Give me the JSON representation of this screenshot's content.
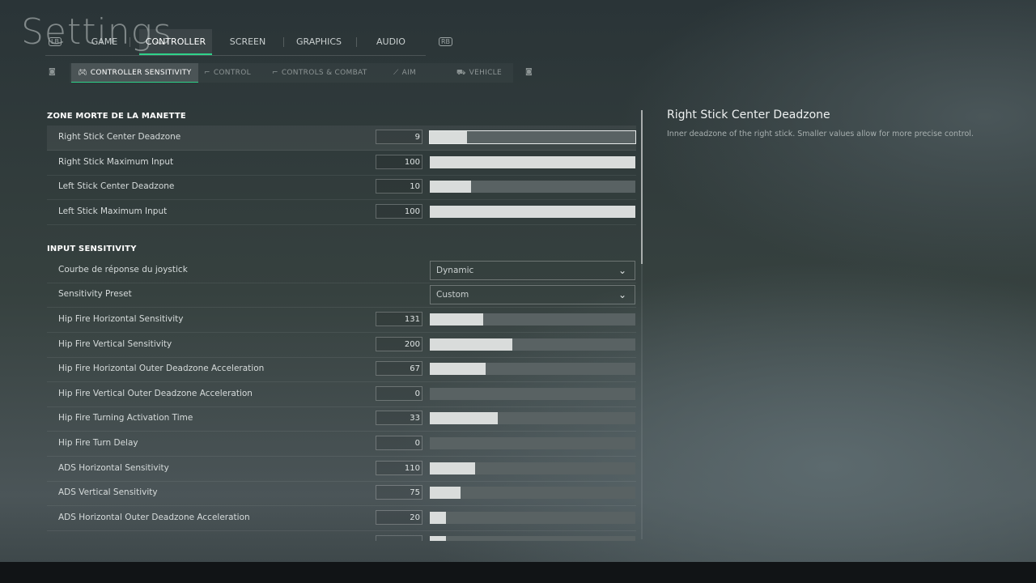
{
  "page": {
    "title": "Settings"
  },
  "tabs": [
    {
      "label": "GAME",
      "active": false
    },
    {
      "label": "CONTROLLER",
      "active": true
    },
    {
      "label": "SCREEN",
      "active": false
    },
    {
      "label": "GRAPHICS",
      "active": false
    },
    {
      "label": "AUDIO",
      "active": false
    }
  ],
  "subtabs": [
    {
      "label": "CONTROLLER SENSITIVITY",
      "icon": "gamepad-icon",
      "active": true
    },
    {
      "label": "CONTROL",
      "icon": "rifle-icon",
      "active": false
    },
    {
      "label": "CONTROLS & COMBAT",
      "icon": "rifle-icon",
      "active": false
    },
    {
      "label": "AIM",
      "icon": "sight-icon",
      "active": false
    },
    {
      "label": "VEHICLE",
      "icon": "vehicle-icon",
      "active": false
    }
  ],
  "sections": {
    "deadzone": {
      "title": "ZONE MORTE DE LA MANETTE",
      "rows": [
        {
          "label": "Right Stick Center Deadzone",
          "value": "9",
          "fill": 0.18,
          "selected": true
        },
        {
          "label": "Right Stick Maximum Input",
          "value": "100",
          "fill": 1.0
        },
        {
          "label": "Left Stick Center Deadzone",
          "value": "10",
          "fill": 0.2
        },
        {
          "label": "Left Stick Maximum Input",
          "value": "100",
          "fill": 1.0
        }
      ]
    },
    "sensitivity": {
      "title": "INPUT SENSITIVITY",
      "dropdowns": [
        {
          "label": "Courbe de réponse du joystick",
          "value": "Dynamic"
        },
        {
          "label": "Sensitivity Preset",
          "value": "Custom"
        }
      ],
      "rows": [
        {
          "label": "Hip Fire Horizontal Sensitivity",
          "value": "131",
          "fill": 0.26
        },
        {
          "label": "Hip Fire Vertical Sensitivity",
          "value": "200",
          "fill": 0.4
        },
        {
          "label": "Hip Fire Horizontal Outer Deadzone Acceleration",
          "value": "67",
          "fill": 0.27
        },
        {
          "label": "Hip Fire Vertical Outer Deadzone Acceleration",
          "value": "0",
          "fill": 0.0
        },
        {
          "label": "Hip Fire Turning Activation Time",
          "value": "33",
          "fill": 0.33
        },
        {
          "label": "Hip Fire Turn Delay",
          "value": "0",
          "fill": 0.0
        },
        {
          "label": "ADS Horizontal Sensitivity",
          "value": "110",
          "fill": 0.22
        },
        {
          "label": "ADS Vertical Sensitivity",
          "value": "75",
          "fill": 0.15
        },
        {
          "label": "ADS Horizontal Outer Deadzone Acceleration",
          "value": "20",
          "fill": 0.08
        }
      ]
    }
  },
  "description": {
    "title": "Right Stick Center Deadzone",
    "text": "Inner deadzone of the right stick. Smaller values allow for more precise control."
  }
}
